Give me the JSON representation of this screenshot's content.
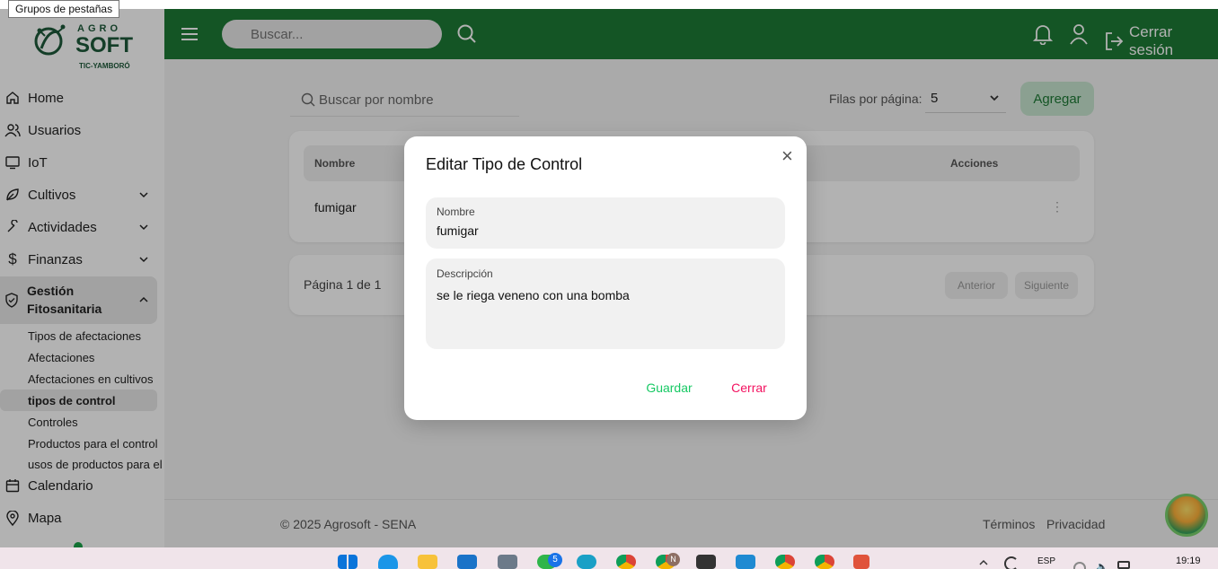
{
  "tooltip": "Grupos de pestañas",
  "logo": {
    "top": "AGRO",
    "main": "SOFT",
    "bottom": "TIC-YAMBORÓ"
  },
  "sidebar": {
    "items": [
      {
        "label": "Home"
      },
      {
        "label": "Usuarios"
      },
      {
        "label": "IoT"
      },
      {
        "label": "Cultivos"
      },
      {
        "label": "Actividades"
      },
      {
        "label": "Finanzas"
      },
      {
        "label": "Gestión Fitosanitaria"
      },
      {
        "label": "Calendario"
      },
      {
        "label": "Mapa"
      }
    ],
    "gestion_line1": "Gestión",
    "gestion_line2": "Fitosanitaria",
    "subitems": [
      "Tipos de afectaciones",
      "Afectaciones",
      "Afectaciones en cultivos",
      "tipos de control",
      "Controles",
      "Productos para el control",
      "usos de productos para el"
    ]
  },
  "header": {
    "search_placeholder": "Buscar...",
    "logout_label": "Cerrar sesión"
  },
  "main": {
    "search_placeholder": "Buscar por nombre",
    "rows_per_page_label": "Filas por página:",
    "rows_per_page_value": "5",
    "add_button": "Agregar",
    "table": {
      "columns": [
        "Nombre",
        "Acciones"
      ],
      "rows": [
        {
          "nombre": "fumigar",
          "actions_icon": "⋮"
        }
      ]
    },
    "pagination": {
      "info": "Página 1 de 1",
      "prev": "Anterior",
      "next": "Siguiente"
    }
  },
  "footer": {
    "copyright": "© 2025 Agrosoft - SENA",
    "terms": "Términos",
    "privacy": "Privacidad"
  },
  "modal": {
    "title": "Editar Tipo de Control",
    "close_glyph": "×",
    "nombre_label": "Nombre",
    "nombre_value": "fumigar",
    "descripcion_label": "Descripción",
    "descripcion_value": "se le riega veneno con una bomba",
    "save_button": "Guardar",
    "close_button": "Cerrar"
  },
  "taskbar": {
    "language": "ESP",
    "time": "19:19",
    "badge_count": "5",
    "avatar_letter": "N"
  },
  "colors": {
    "brand_green": "#1e7a36",
    "accent_green": "#17c964",
    "danger_pink": "#f31260",
    "add_button_bg": "#c8e6d0"
  }
}
